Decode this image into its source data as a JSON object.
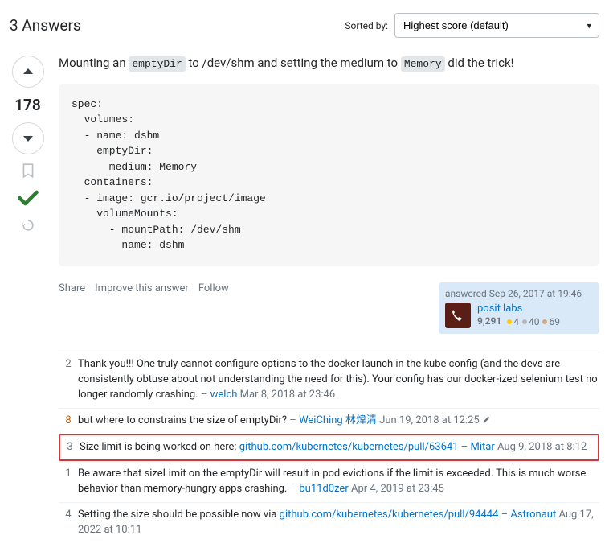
{
  "header": {
    "title": "3 Answers",
    "sort_label": "Sorted by:",
    "sort_selected": "Highest score (default)"
  },
  "answer": {
    "score": "178",
    "body_prefix": "Mounting an ",
    "body_code1": "emptyDir",
    "body_mid": " to /dev/shm and setting the medium to ",
    "body_code2": "Memory",
    "body_suffix": " did the trick!",
    "code": "spec:\n  volumes:\n  - name: dshm\n    emptyDir:\n      medium: Memory\n  containers:\n  - image: gcr.io/project/image\n    volumeMounts:\n      - mountPath: /dev/shm\n        name: dshm",
    "actions": {
      "share": "Share",
      "improve": "Improve this answer",
      "follow": "Follow"
    },
    "usercard": {
      "when": "answered Sep 26, 2017 at 19:46",
      "name": "posit labs",
      "rep": "9,291",
      "gold": "4",
      "silver": "40",
      "bronze": "69"
    }
  },
  "comments": [
    {
      "score": "2",
      "text": "Thank you!!! One truly cannot configure options to the docker launch in the kube config (and the devs are consistently obtuse about not understanding the need for this). Your config has our docker-ized selenium test no longer randomly crashing.",
      "user": "welch",
      "ts": "Mar 8, 2018 at 23:46",
      "warm": false,
      "edited": false,
      "link": null,
      "suffix": null,
      "highlighted": false
    },
    {
      "score": "8",
      "text": "but where to constrains the size of emptyDir?",
      "user": "WeiChing 林煒清",
      "ts": "Jun 19, 2018 at 12:25",
      "warm": true,
      "edited": true,
      "link": null,
      "suffix": null,
      "highlighted": false
    },
    {
      "score": "3",
      "text": "Size limit is being worked on here: ",
      "link": "github.com/kubernetes/kubernetes/pull/63641",
      "suffix": null,
      "user": "Mitar",
      "ts": "Aug 9, 2018 at 8:12",
      "warm": false,
      "edited": false,
      "highlighted": true
    },
    {
      "score": "1",
      "text": "Be aware that sizeLimit on the emptyDir will result in pod evictions if the limit is exceeded. This is much worse behavior than memory-hungry apps crashing.",
      "user": "bu11d0zer",
      "ts": "Apr 4, 2019 at 23:45",
      "warm": false,
      "edited": false,
      "link": null,
      "suffix": null,
      "highlighted": false
    },
    {
      "score": "4",
      "text": "Setting the size should be possible now via ",
      "link": "github.com/kubernetes/kubernetes/pull/94444",
      "suffix": null,
      "user": "Astronaut",
      "ts": "Aug 17, 2022 at 10:11",
      "warm": false,
      "edited": false,
      "highlighted": false
    }
  ]
}
